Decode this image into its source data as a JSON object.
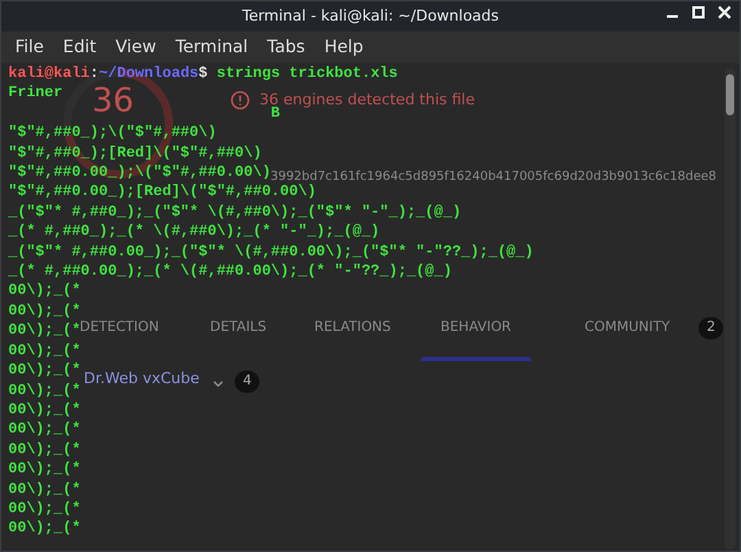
{
  "window": {
    "title": "Terminal - kali@kali: ~/Downloads"
  },
  "menu": [
    "File",
    "Edit",
    "View",
    "Terminal",
    "Tabs",
    "Help"
  ],
  "prompt": {
    "user": "kali@kali",
    "separator": ":",
    "path": "~/Downloads",
    "symbol": "$",
    "command": "strings trickbot.xls"
  },
  "output_lines": [
    "Friner",
    "                             B",
    "\"$\"#,##0_);\\(\"$\"#,##0\\)",
    "\"$\"#,##0_);[Red]\\(\"$\"#,##0\\)",
    "\"$\"#,##0.00_);\\(\"$\"#,##0.00\\)",
    "\"$\"#,##0.00_);[Red]\\(\"$\"#,##0.00\\)",
    "_(\"$\"* #,##0_);_(\"$\"* \\(#,##0\\);_(\"$\"* \"-\"_);_(@_)",
    "_(* #,##0_);_(* \\(#,##0\\);_(* \"-\"_);_(@_)",
    "_(\"$\"* #,##0.00_);_(\"$\"* \\(#,##0.00\\);_(\"$\"* \"-\"??_);_(@_)",
    "_(* #,##0.00_);_(* \\(#,##0.00\\);_(* \"-\"??_);_(@_)",
    "00\\);_(*",
    "00\\);_(*",
    "00\\);_(*",
    "00\\);_(*",
    "00\\);_(*",
    "00\\);_(*",
    "00\\);_(*",
    "00\\);_(*",
    "00\\);_(*",
    "00\\);_(*",
    "00\\);_(*",
    "00\\);_(*",
    "00\\);_(*"
  ],
  "background_page": {
    "score": "36",
    "alert": "36 engines detected this file",
    "hash": "3992bd7c161fc1964c5d895f16240b417005fc69d20d3b9013c6c18dee8",
    "tabs": [
      {
        "label": "DETECTION",
        "selected": false
      },
      {
        "label": "DETAILS",
        "selected": false
      },
      {
        "label": "RELATIONS",
        "selected": false
      },
      {
        "label": "BEHAVIOR",
        "selected": true
      },
      {
        "label": "COMMUNITY",
        "selected": false,
        "count": "2"
      }
    ],
    "sandbox": {
      "name": "Dr.Web vxCube",
      "count": "4"
    }
  }
}
